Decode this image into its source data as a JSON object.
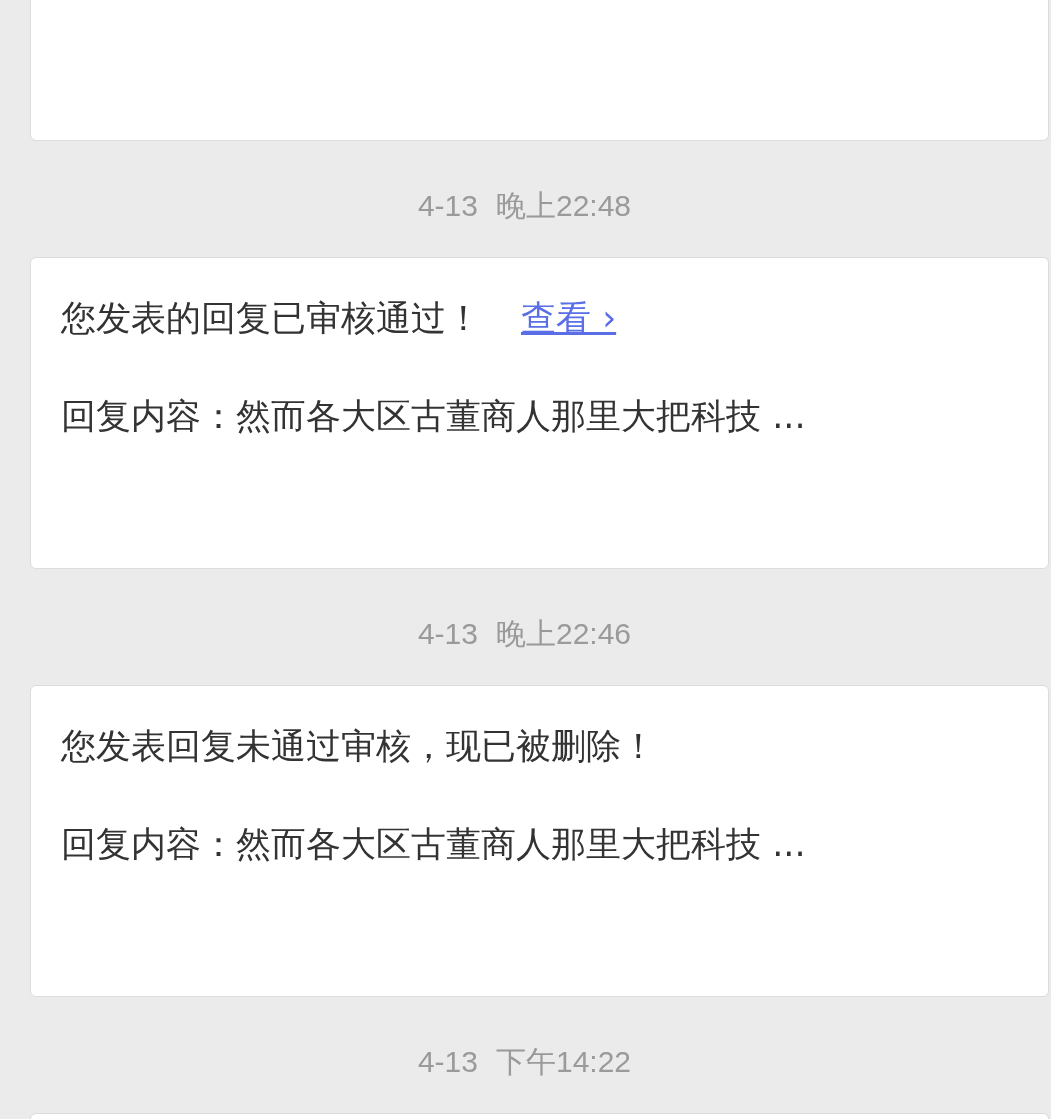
{
  "messages": [
    {
      "date": "4-13",
      "time": "晚上22:48",
      "title": "您发表的回复已审核通过！",
      "link": "查看 ›",
      "content": "回复内容：然而各大区古董商人那里大把科技 ..."
    },
    {
      "date": "4-13",
      "time": "晚上22:46",
      "title": "您发表回复未通过审核，现已被删除！",
      "content": "回复内容：然而各大区古董商人那里大把科技 ..."
    },
    {
      "date": "4-13",
      "time": "下午14:22"
    }
  ]
}
